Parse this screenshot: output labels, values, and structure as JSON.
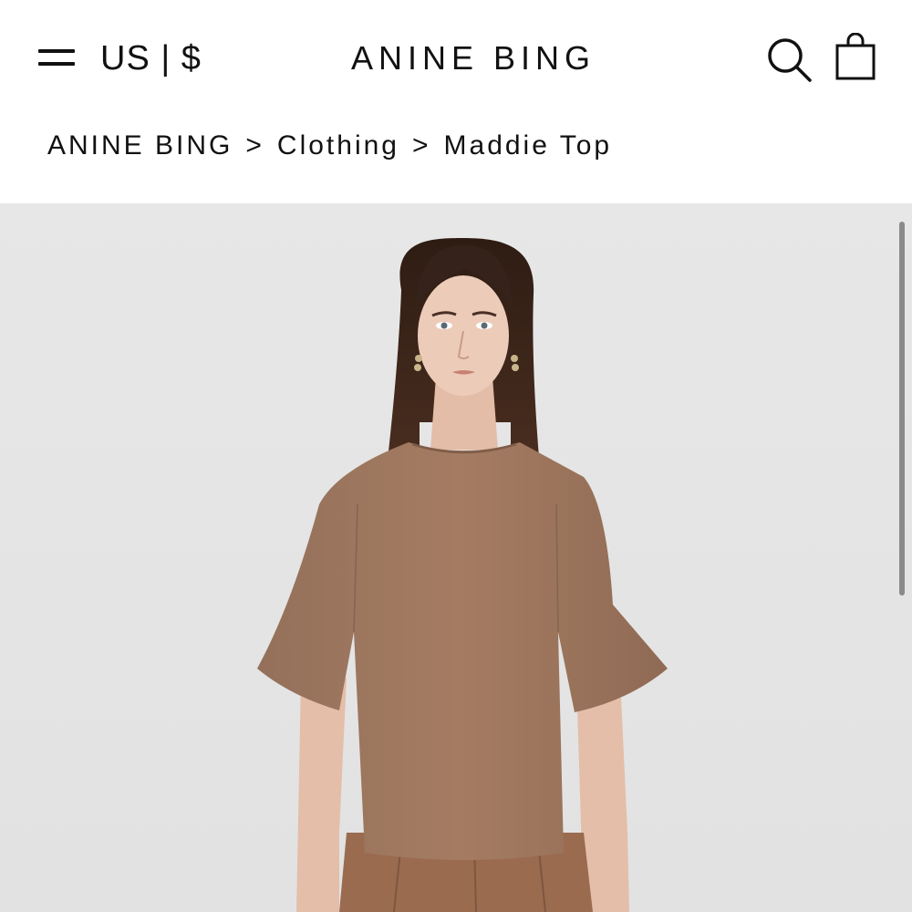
{
  "header": {
    "locale_label": "US | $",
    "brand": "ANINE BING"
  },
  "breadcrumb": {
    "items": [
      "ANINE BING",
      "Clothing",
      "Maddie Top"
    ],
    "separator": ">"
  },
  "product_image": {
    "alt": "Maddie Top",
    "colors": {
      "background": "#e5e5e5",
      "top": "#a27a61",
      "skin": "#e8c6b2",
      "hair": "#3a2419"
    }
  }
}
